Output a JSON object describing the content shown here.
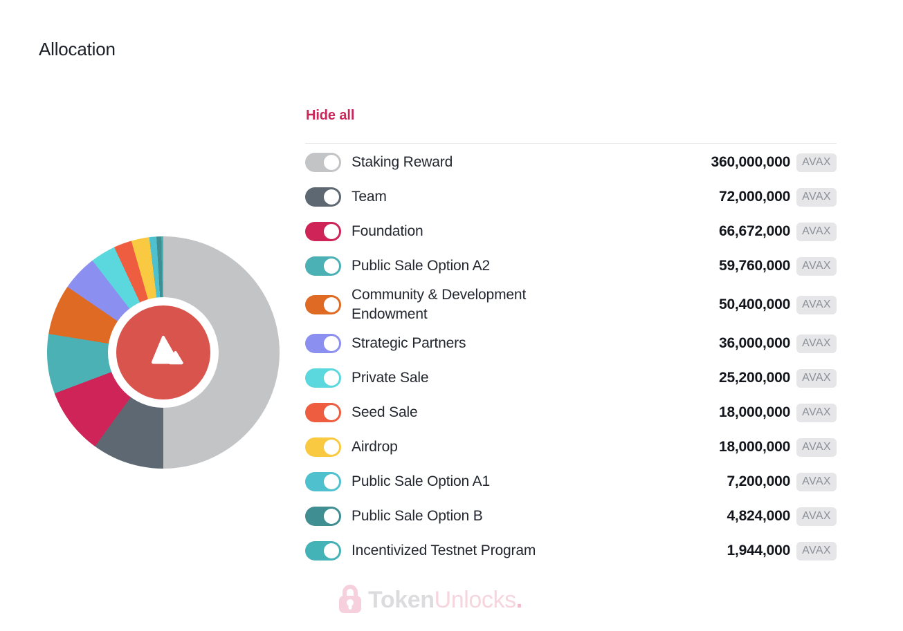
{
  "page": {
    "title": "Allocation"
  },
  "legend": {
    "hide_all_label": "Hide all",
    "hide_all_color": "#c9265a",
    "unit": "AVAX"
  },
  "watermark": {
    "icon": "lock-icon",
    "text_primary": "Token",
    "text_secondary": "Unlocks",
    "text_dot": "."
  },
  "chart_data": {
    "type": "pie",
    "title": "Allocation",
    "unit": "AVAX",
    "total": 720000000,
    "donut": true,
    "start_angle_deg": 0,
    "direction": "clockwise",
    "center_logo": "avax-logo",
    "center_logo_color": "#d9544c",
    "legend_position": "right",
    "categories": [
      "Staking Reward",
      "Team",
      "Foundation",
      "Public Sale Option A2",
      "Community & Development Endowment",
      "Strategic Partners",
      "Private Sale",
      "Seed Sale",
      "Airdrop",
      "Public Sale Option A1",
      "Public Sale Option B",
      "Incentivized Testnet Program"
    ],
    "values": [
      360000000,
      72000000,
      66672000,
      59760000,
      50400000,
      36000000,
      25200000,
      18000000,
      18000000,
      7200000,
      4824000,
      1944000
    ],
    "value_labels": [
      "360,000,000",
      "72,000,000",
      "66,672,000",
      "59,760,000",
      "50,400,000",
      "36,000,000",
      "25,200,000",
      "18,000,000",
      "18,000,000",
      "7,200,000",
      "4,824,000",
      "1,944,000"
    ],
    "colors": [
      "#c3c4c6",
      "#5d6872",
      "#ce2458",
      "#4bb1b5",
      "#de6a24",
      "#8b90f0",
      "#5bd8dd",
      "#ee5d3f",
      "#f9c941",
      "#4fc0ce",
      "#3f8e92",
      "#44b3b7"
    ],
    "toggles_on": [
      false,
      true,
      true,
      true,
      true,
      true,
      true,
      true,
      true,
      true,
      true,
      true
    ]
  },
  "rows": [
    {
      "label": "Staking Reward",
      "value": "360,000,000",
      "unit": "AVAX",
      "color": "#c3c4c6",
      "on": false,
      "tall": false
    },
    {
      "label": "Team",
      "value": "72,000,000",
      "unit": "AVAX",
      "color": "#5d6872",
      "on": true,
      "tall": false
    },
    {
      "label": "Foundation",
      "value": "66,672,000",
      "unit": "AVAX",
      "color": "#ce2458",
      "on": true,
      "tall": false
    },
    {
      "label": "Public Sale Option A2",
      "value": "59,760,000",
      "unit": "AVAX",
      "color": "#4bb1b5",
      "on": true,
      "tall": false
    },
    {
      "label": "Community & Development\nEndowment",
      "value": "50,400,000",
      "unit": "AVAX",
      "color": "#de6a24",
      "on": true,
      "tall": true
    },
    {
      "label": "Strategic Partners",
      "value": "36,000,000",
      "unit": "AVAX",
      "color": "#8b90f0",
      "on": true,
      "tall": false
    },
    {
      "label": "Private Sale",
      "value": "25,200,000",
      "unit": "AVAX",
      "color": "#5bd8dd",
      "on": true,
      "tall": false
    },
    {
      "label": "Seed Sale",
      "value": "18,000,000",
      "unit": "AVAX",
      "color": "#ee5d3f",
      "on": true,
      "tall": false
    },
    {
      "label": "Airdrop",
      "value": "18,000,000",
      "unit": "AVAX",
      "color": "#f9c941",
      "on": true,
      "tall": false
    },
    {
      "label": "Public Sale Option A1",
      "value": "7,200,000",
      "unit": "AVAX",
      "color": "#4fc0ce",
      "on": true,
      "tall": false
    },
    {
      "label": "Public Sale Option B",
      "value": "4,824,000",
      "unit": "AVAX",
      "color": "#3f8e92",
      "on": true,
      "tall": false
    },
    {
      "label": "Incentivized Testnet Program",
      "value": "1,944,000",
      "unit": "AVAX",
      "color": "#44b3b7",
      "on": true,
      "tall": false
    }
  ]
}
